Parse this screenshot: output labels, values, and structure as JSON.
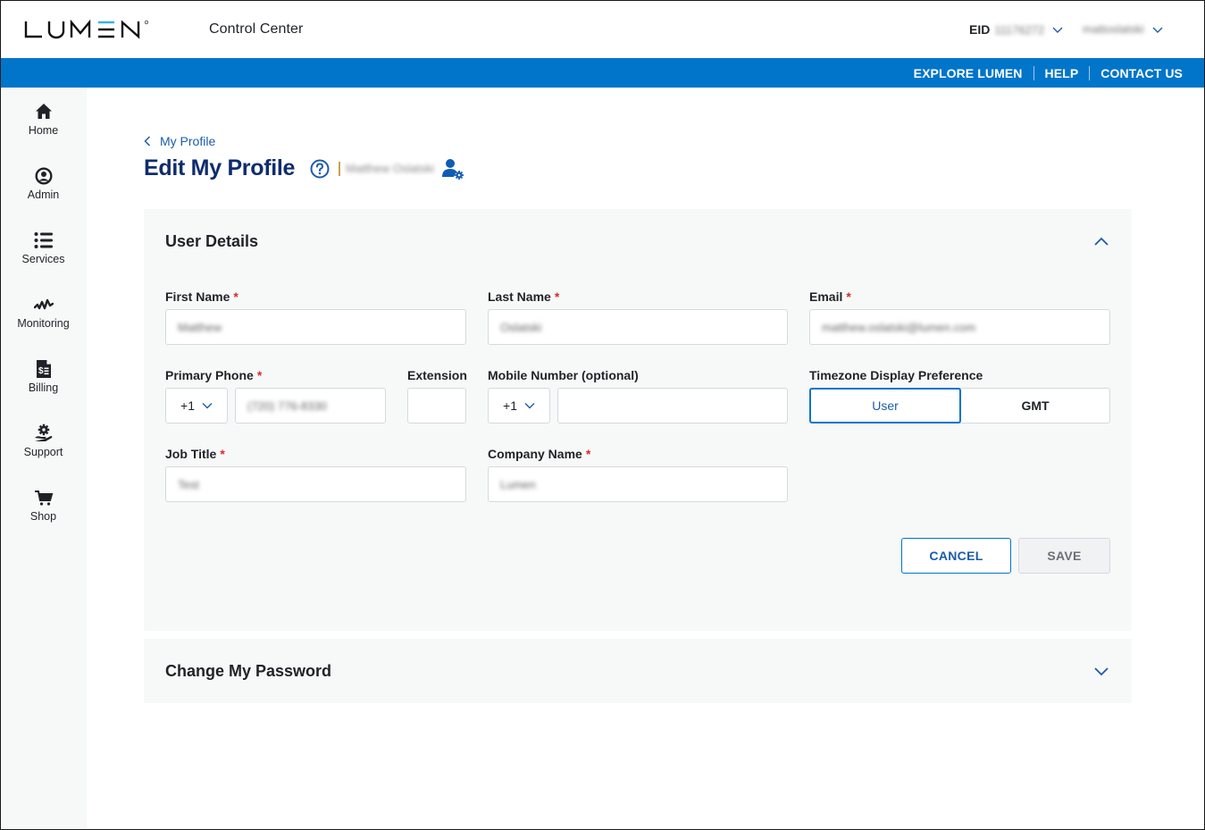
{
  "header": {
    "brand": "LUMEN",
    "app_title": "Control Center",
    "eid_label": "EID",
    "eid_value": "11176272",
    "username": "mattoslatski"
  },
  "nav": {
    "links": [
      "EXPLORE LUMEN",
      "HELP",
      "CONTACT US"
    ]
  },
  "sidebar": {
    "items": [
      {
        "label": "Home",
        "icon": "home-icon"
      },
      {
        "label": "Admin",
        "icon": "user-circle-icon"
      },
      {
        "label": "Services",
        "icon": "list-icon"
      },
      {
        "label": "Monitoring",
        "icon": "pulse-icon"
      },
      {
        "label": "Billing",
        "icon": "invoice-icon"
      },
      {
        "label": "Support",
        "icon": "hand-gear-icon"
      },
      {
        "label": "Shop",
        "icon": "cart-icon"
      }
    ]
  },
  "page": {
    "back_label": "My Profile",
    "title": "Edit My Profile",
    "user_name": "Matthew Oslatski"
  },
  "user_details": {
    "title": "User Details",
    "first_name": {
      "label": "First Name",
      "value": "Matthew",
      "required": true
    },
    "last_name": {
      "label": "Last Name",
      "value": "Oslatski",
      "required": true
    },
    "email": {
      "label": "Email",
      "value": "matthew.oslatski@lumen.com",
      "required": true
    },
    "primary_phone": {
      "label": "Primary Phone",
      "country_code": "+1",
      "value": "(720) 776-8330",
      "required": true
    },
    "extension": {
      "label": "Extension",
      "value": ""
    },
    "mobile": {
      "label": "Mobile Number (optional)",
      "country_code": "+1",
      "value": ""
    },
    "timezone": {
      "label": "Timezone Display Preference",
      "options": [
        "User",
        "GMT"
      ],
      "selected": "User"
    },
    "job_title": {
      "label": "Job Title",
      "value": "Test",
      "required": true
    },
    "company_name": {
      "label": "Company Name",
      "value": "Lumen",
      "required": true
    },
    "required_marker": "*",
    "cancel_label": "CANCEL",
    "save_label": "SAVE"
  },
  "change_password": {
    "title": "Change My Password"
  },
  "colors": {
    "brand_blue": "#0075c9",
    "title_navy": "#0f2d6b",
    "link_blue": "#1c5cab",
    "required_red": "#d62b2b"
  }
}
